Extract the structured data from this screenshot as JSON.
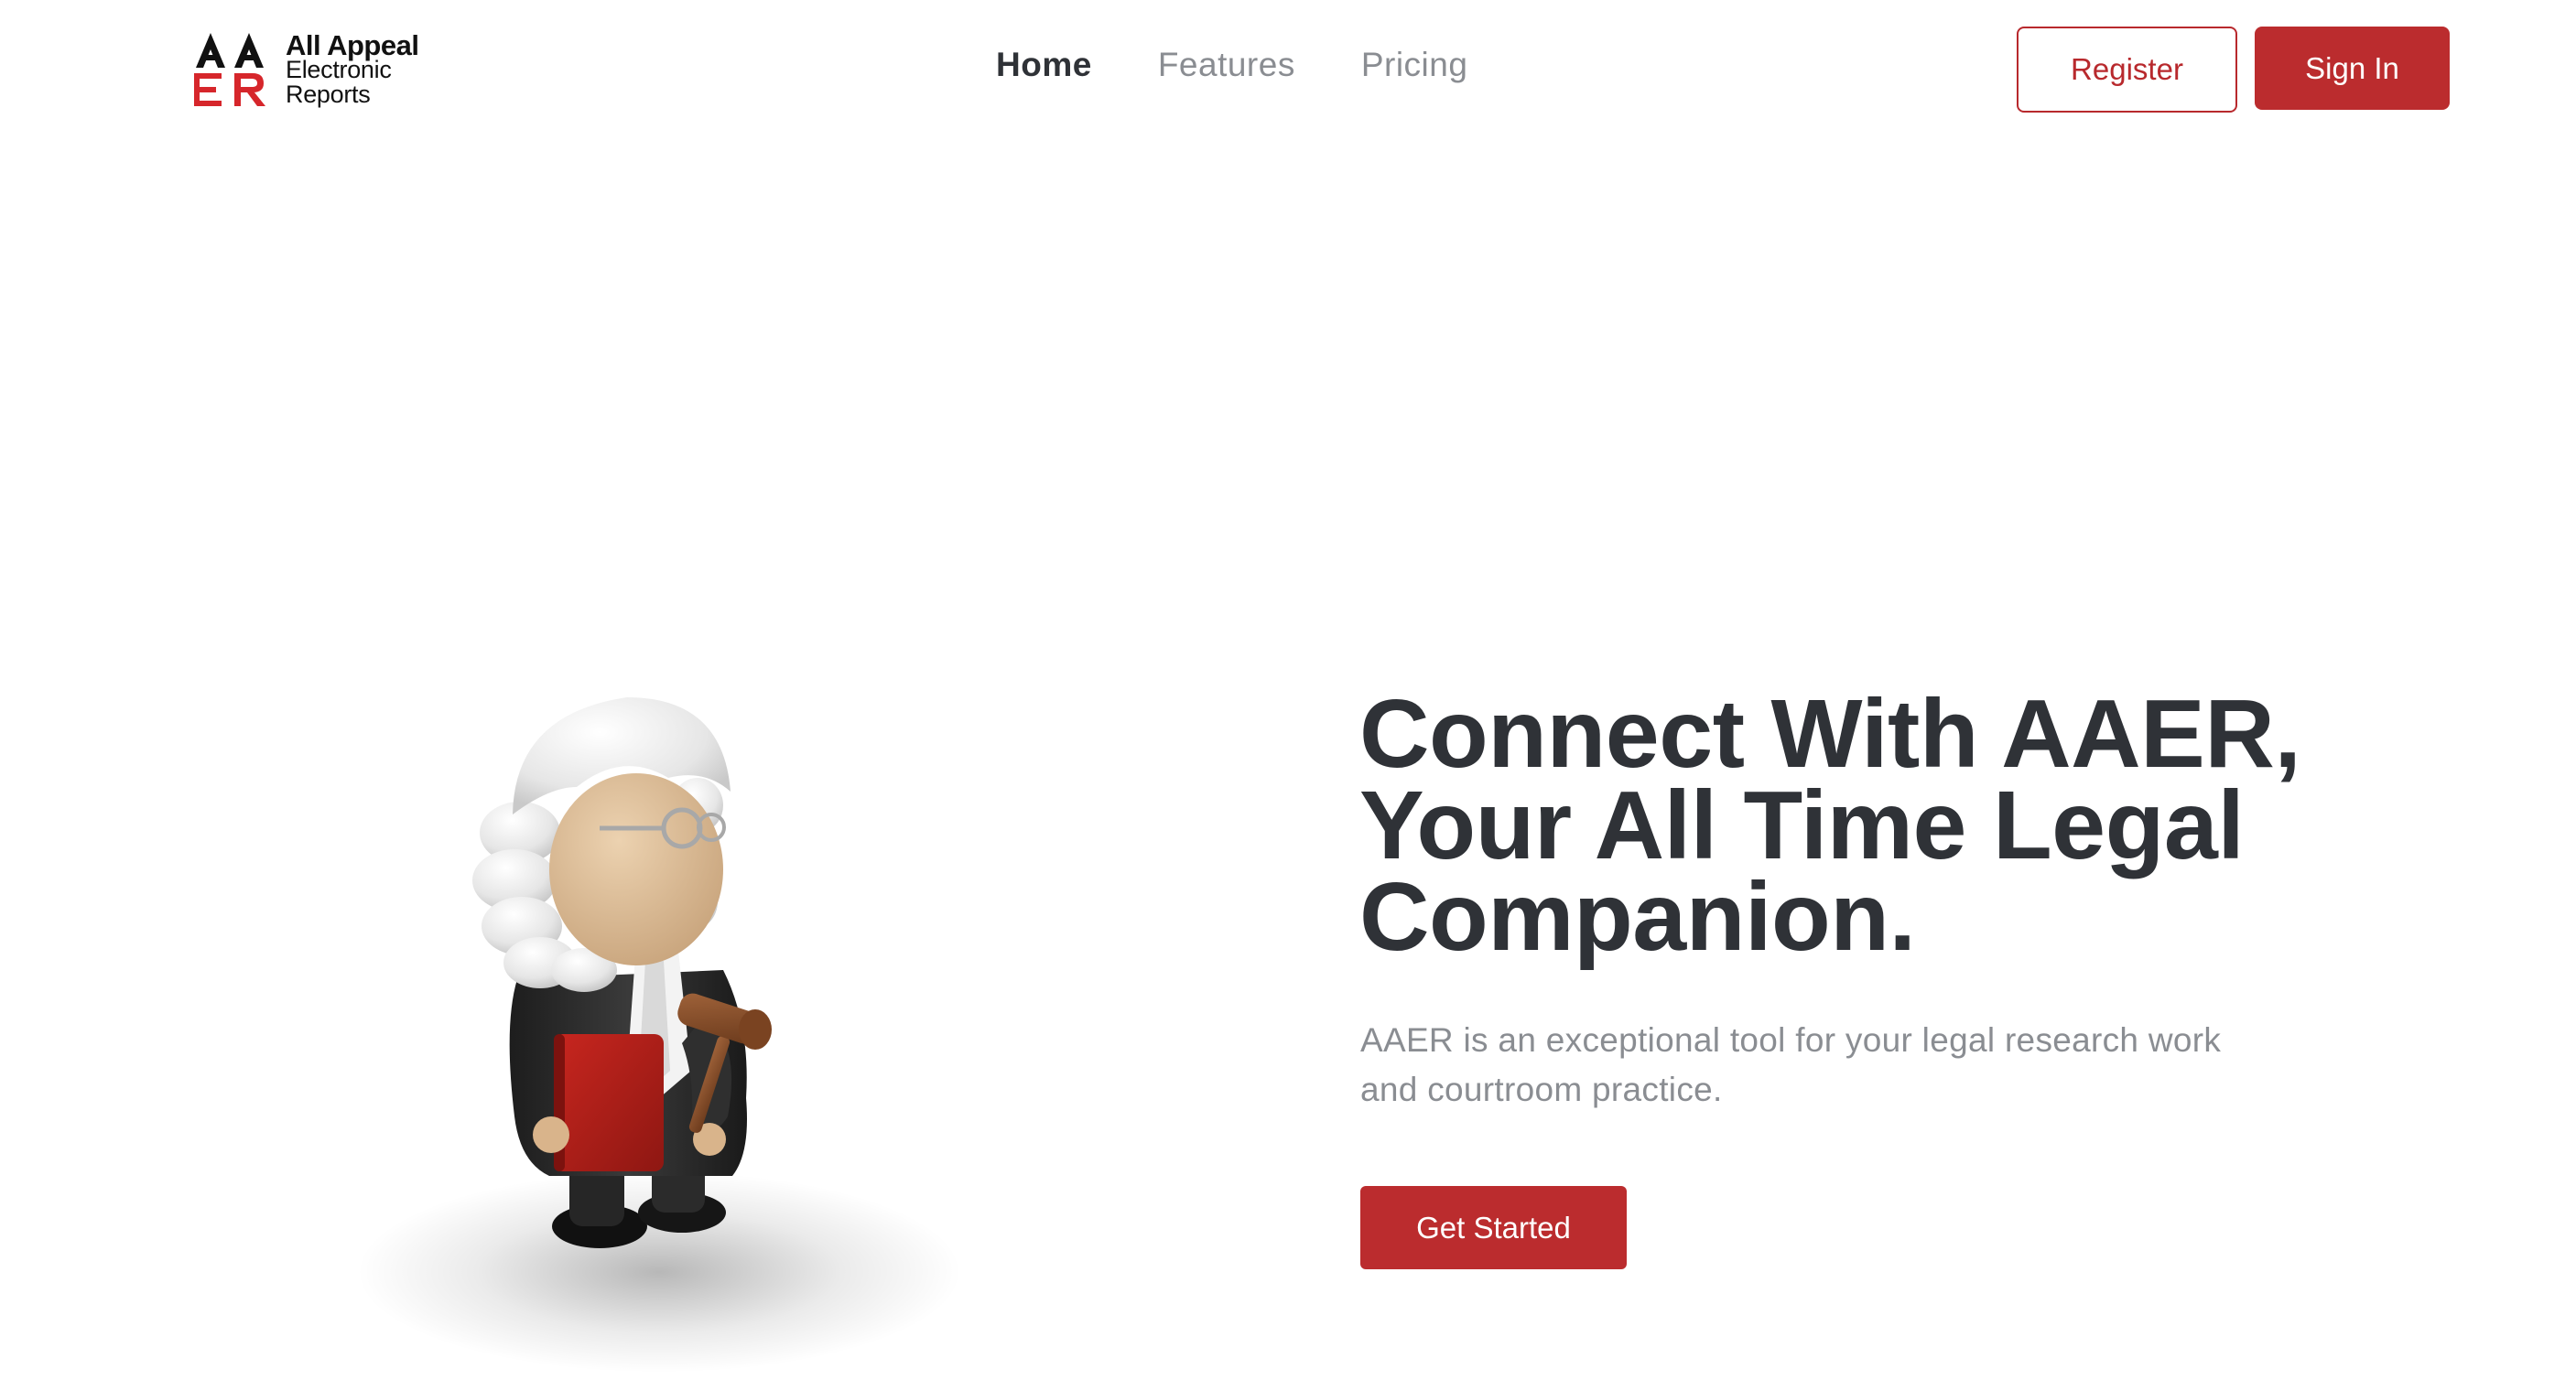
{
  "header": {
    "logo": {
      "mark_top": "AA",
      "mark_bottom": "ER",
      "line1": "All Appeal",
      "line2": "Electronic",
      "line3": "Reports"
    },
    "nav": [
      {
        "label": "Home",
        "active": true
      },
      {
        "label": "Features",
        "active": false
      },
      {
        "label": "Pricing",
        "active": false
      }
    ],
    "register_label": "Register",
    "signin_label": "Sign In"
  },
  "hero": {
    "title_line1": "Connect With AAER,",
    "title_line2": "Your All Time Legal",
    "title_line3": "Companion.",
    "subtitle_line1": "AAER is an exceptional tool for your legal research work",
    "subtitle_line2": "and courtroom practice.",
    "cta_label": "Get Started",
    "illustration_icon": "judge-mascot-icon"
  },
  "colors": {
    "brand_red": "#bb2c2e",
    "heading": "#2f3237",
    "muted": "#8a8d92"
  }
}
